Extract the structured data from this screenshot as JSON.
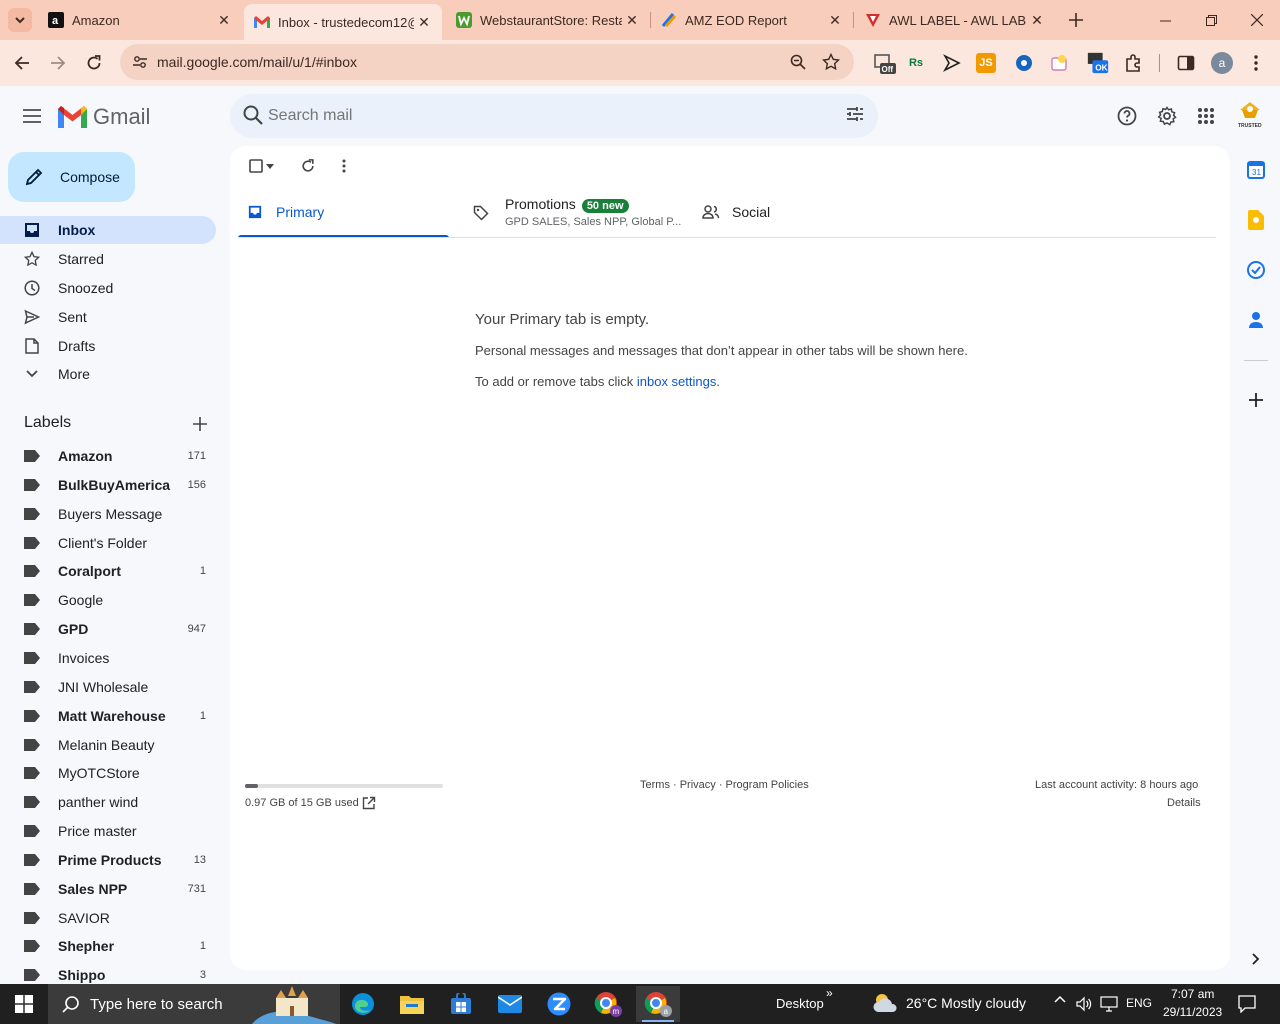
{
  "browser": {
    "tabs": [
      {
        "title": "Amazon",
        "icon": "amazon-icon",
        "active": false
      },
      {
        "title": "Inbox - trustedecom12@",
        "icon": "gmail-icon",
        "active": true
      },
      {
        "title": "WebstaurantStore: Restau",
        "icon": "webstaurant-icon",
        "active": false
      },
      {
        "title": "AMZ EOD Report",
        "icon": "report-icon",
        "active": false
      },
      {
        "title": "AWL LABEL - AWL LABEL",
        "icon": "awl-icon",
        "active": false
      }
    ],
    "url": "mail.google.com/mail/u/1/#inbox",
    "ext_off": "Off",
    "ext_ok": "OK",
    "ext_js": "JS",
    "ext_rs": "Rs",
    "profile_initial": "a",
    "colors": {
      "tabstrip": "#f9cdbb",
      "toolbar": "#fbe7de"
    }
  },
  "gmail": {
    "brand": "Gmail",
    "search_placeholder": "Search mail",
    "account_logo_text": "TRUSTED",
    "compose_label": "Compose",
    "nav": [
      {
        "label": "Inbox",
        "icon": "inbox-icon",
        "selected": true
      },
      {
        "label": "Starred",
        "icon": "star-icon",
        "selected": false
      },
      {
        "label": "Snoozed",
        "icon": "clock-icon",
        "selected": false
      },
      {
        "label": "Sent",
        "icon": "send-icon",
        "selected": false
      },
      {
        "label": "Drafts",
        "icon": "draft-icon",
        "selected": false
      },
      {
        "label": "More",
        "icon": "chevron-down-icon",
        "selected": false
      }
    ],
    "labels_heading": "Labels",
    "labels": [
      {
        "name": "Amazon",
        "count": "171",
        "bold": true
      },
      {
        "name": "BulkBuyAmerica",
        "count": "156",
        "bold": true
      },
      {
        "name": "Buyers Message",
        "count": "",
        "bold": false
      },
      {
        "name": "Client's Folder",
        "count": "",
        "bold": false
      },
      {
        "name": "Coralport",
        "count": "1",
        "bold": true
      },
      {
        "name": "Google",
        "count": "",
        "bold": false
      },
      {
        "name": "GPD",
        "count": "947",
        "bold": true
      },
      {
        "name": "Invoices",
        "count": "",
        "bold": false
      },
      {
        "name": "JNI Wholesale",
        "count": "",
        "bold": false
      },
      {
        "name": "Matt Warehouse",
        "count": "1",
        "bold": true
      },
      {
        "name": "Melanin Beauty",
        "count": "",
        "bold": false
      },
      {
        "name": "MyOTCStore",
        "count": "",
        "bold": false
      },
      {
        "name": "panther wind",
        "count": "",
        "bold": false
      },
      {
        "name": "Price master",
        "count": "",
        "bold": false
      },
      {
        "name": "Prime Products",
        "count": "13",
        "bold": true
      },
      {
        "name": "Sales NPP",
        "count": "731",
        "bold": true
      },
      {
        "name": "SAVIOR",
        "count": "",
        "bold": false
      },
      {
        "name": "Shepher",
        "count": "1",
        "bold": true
      },
      {
        "name": "Shippo",
        "count": "3",
        "bold": true
      }
    ],
    "inbox_tabs": [
      {
        "label": "Primary",
        "icon": "inbox-tab-icon",
        "active": true
      },
      {
        "label": "Promotions",
        "icon": "tag-icon",
        "badge": "50 new",
        "subtitle": "GPD SALES, Sales NPP, Global P..."
      },
      {
        "label": "Social",
        "icon": "people-icon"
      }
    ],
    "empty": {
      "title": "Your Primary tab is empty.",
      "line1": "Personal messages and messages that don’t appear in other tabs will be shown here.",
      "line2_prefix": "To add or remove tabs click ",
      "line2_link": "inbox settings",
      "line2_suffix": "."
    },
    "footer": {
      "storage_text": "0.97 GB of 15 GB used",
      "storage_fraction": 0.065,
      "links": "Terms · Privacy · Program Policies",
      "activity": "Last account activity: 8 hours ago",
      "details": "Details"
    }
  },
  "taskbar": {
    "search_placeholder": "Type here to search",
    "desktop_label": "Desktop",
    "weather": "26°C  Mostly cloudy",
    "language": "ENG",
    "time": "7:07 am",
    "date": "29/11/2023"
  }
}
